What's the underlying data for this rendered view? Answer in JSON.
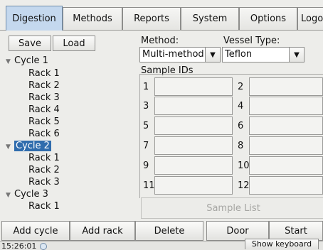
{
  "tabs": [
    {
      "label": "Digestion",
      "active": true
    },
    {
      "label": "Methods"
    },
    {
      "label": "Reports"
    },
    {
      "label": "System"
    },
    {
      "label": "Options"
    },
    {
      "label": "Logou"
    }
  ],
  "toolbar": {
    "save_label": "Save",
    "load_label": "Load"
  },
  "tree": [
    {
      "label": "Cycle 1",
      "expanded": true
    },
    {
      "label": "Rack 1"
    },
    {
      "label": "Rack 2"
    },
    {
      "label": "Rack 3"
    },
    {
      "label": "Rack 4"
    },
    {
      "label": "Rack 5"
    },
    {
      "label": "Rack 6"
    },
    {
      "label": "Cycle 2",
      "expanded": true,
      "selected": true
    },
    {
      "label": "Rack 1"
    },
    {
      "label": "Rack 2"
    },
    {
      "label": "Rack 3"
    },
    {
      "label": "Cycle 3",
      "expanded": true
    },
    {
      "label": "Rack 1"
    }
  ],
  "method": {
    "label": "Method:",
    "value": "Multi-method"
  },
  "vessel": {
    "label": "Vessel Type:",
    "value": "Teflon"
  },
  "sample_ids": {
    "label": "Sample IDs",
    "slots": [
      "1",
      "2",
      "3",
      "4",
      "5",
      "6",
      "7",
      "8",
      "9",
      "10",
      "11",
      "12"
    ]
  },
  "sample_list_label": "Sample List",
  "bottom_buttons": [
    "Add cycle",
    "Add rack",
    "Delete",
    "Door",
    "Start"
  ],
  "status": {
    "time": "15:26:01",
    "keyboard_label": "Show keyboard"
  }
}
